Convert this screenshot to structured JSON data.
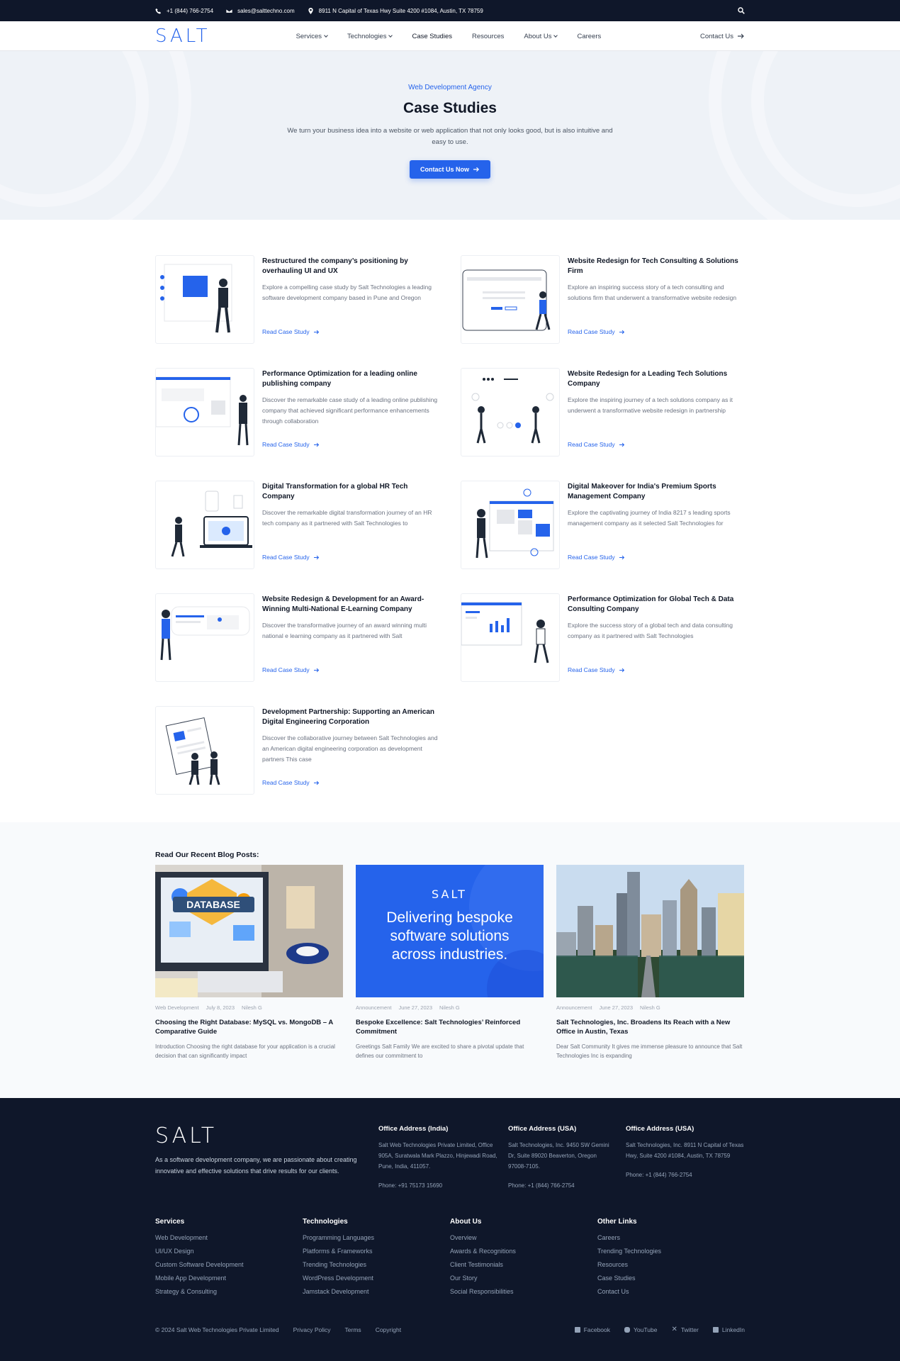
{
  "topbar": {
    "phone": "+1 (844) 766-2754",
    "email": "sales@salttechno.com",
    "address": "8911 N Capital of Texas Hwy Suite 4200 #1084, Austin, TX 78759",
    "icons": [
      "phone-icon",
      "mail-icon",
      "location-icon",
      "search-icon"
    ]
  },
  "nav": {
    "logo": "SALT",
    "items": [
      {
        "label": "Services"
      },
      {
        "label": "Technologies"
      },
      {
        "label": "Case Studies"
      },
      {
        "label": "Resources"
      },
      {
        "label": "About Us"
      },
      {
        "label": "Careers"
      }
    ],
    "contact": "Contact Us"
  },
  "hero": {
    "eyebrow": "Web Development Agency",
    "title": "Case Studies",
    "description": "We turn your business idea into a website or web application that not only looks good, but is also intuitive and easy to use.",
    "button": "Contact Us Now"
  },
  "cases": [
    {
      "title": "Restructured the company’s positioning by overhauling UI and UX",
      "desc": "Explore a compelling case study by Salt Technologies a leading software development company based in Pune and Oregon",
      "link": "Read Case Study"
    },
    {
      "title": "Website Redesign for Tech Consulting & Solutions Firm",
      "desc": "Explore an inspiring success story of a tech consulting and solutions firm that underwent a transformative website redesign",
      "link": "Read Case Study"
    },
    {
      "title": "Performance Optimization for a leading online publishing company",
      "desc": "Discover the remarkable case study of a leading online publishing company that achieved significant performance enhancements through collaboration",
      "link": "Read Case Study"
    },
    {
      "title": "Website Redesign for a Leading Tech Solutions Company",
      "desc": "Explore the inspiring journey of a tech solutions company as it underwent a transformative website redesign in partnership",
      "link": "Read Case Study"
    },
    {
      "title": "Digital Transformation for a global HR Tech Company",
      "desc": "Discover the remarkable digital transformation journey of an HR tech company as it partnered with Salt Technologies to",
      "link": "Read Case Study"
    },
    {
      "title": "Digital Makeover for India's Premium Sports Management Company",
      "desc": "Explore the captivating journey of India 8217 s leading sports management company as it selected Salt Technologies for",
      "link": "Read Case Study"
    },
    {
      "title": "Website Redesign & Development for an Award-Winning Multi-National E-Learning Company",
      "desc": "Discover the transformative journey of an award winning multi national e learning company as it partnered with Salt",
      "link": "Read Case Study"
    },
    {
      "title": "Performance Optimization for Global Tech & Data Consulting Company",
      "desc": "Explore the success story of a global tech and data consulting company as it partnered with Salt Technologies",
      "link": "Read Case Study"
    },
    {
      "title": "Development Partnership: Supporting an American Digital Engineering Corporation",
      "desc": "Discover the collaborative journey between Salt Technologies and an American digital engineering corporation as development partners This case",
      "link": "Read Case Study"
    }
  ],
  "blog": {
    "heading": "Read Our Recent Blog Posts:",
    "posts": [
      {
        "category": "Web Development",
        "date": "July 8, 2023",
        "author": "Nilesh G",
        "title": "Choosing the Right Database: MySQL vs. MongoDB – A Comparative Guide",
        "excerpt": "Introduction Choosing the right database for your application is a crucial decision that can significantly impact",
        "img_text": "DATABASE"
      },
      {
        "category": "Announcement",
        "date": "June 27, 2023",
        "author": "Nilesh G",
        "title": "Bespoke Excellence: Salt Technologies’ Reinforced Commitment",
        "excerpt": "Greetings Salt Family We are excited to share a pivotal update that defines our commitment to",
        "img_logo": "SALT",
        "img_text": "Delivering bespoke software solutions across industries."
      },
      {
        "category": "Announcement",
        "date": "June 27, 2023",
        "author": "Nilesh G",
        "title": "Salt Technologies, Inc. Broadens Its Reach with a New Office in Austin, Texas",
        "excerpt": "Dear Salt Community It gives me immense pleasure to announce that Salt Technologies Inc is expanding"
      }
    ]
  },
  "footer": {
    "logo": "SALT",
    "about": "As a software development company, we are passionate about creating innovative and effective solutions that drive results for our clients.",
    "offices": [
      {
        "title": "Office Address (India)",
        "address": "Salt Web Technologies Private Limited, Office 905A, Suratwala Mark Plazzo, Hinjewadi Road, Pune, India, 411057.",
        "phone": "Phone: +91 75173 15690"
      },
      {
        "title": "Office Address (USA)",
        "address": "Salt Technologies, Inc. 9450 SW Gemini Dr, Suite 89020 Beaverton, Oregon 97008-7105.",
        "phone": "Phone: +1 (844) 766-2754"
      },
      {
        "title": "Office Address (USA)",
        "address": "Salt Technologies, Inc. 8911 N Capital of Texas Hwy, Suite 4200 #1084, Austin, TX 78759",
        "phone": "Phone: +1 (844) 766-2754"
      }
    ],
    "columns": [
      {
        "title": "Services",
        "links": [
          "Web Development",
          "UI/UX Design",
          "Custom Software Development",
          "Mobile App Development",
          "Strategy & Consulting"
        ]
      },
      {
        "title": "Technologies",
        "links": [
          "Programming Languages",
          "Platforms & Frameworks",
          "Trending Technologies",
          "WordPress Development",
          "Jamstack Development"
        ]
      },
      {
        "title": "About Us",
        "links": [
          "Overview",
          "Awards & Recognitions",
          "Client Testimonials",
          "Our Story",
          "Social Responsibilities"
        ]
      },
      {
        "title": "Other Links",
        "links": [
          "Careers",
          "Trending Technologies",
          "Resources",
          "Case Studies",
          "Contact Us"
        ]
      }
    ],
    "copyright": "© 2024 Salt Web Technologies Private Limited",
    "legal": [
      "Privacy Policy",
      "Terms",
      "Copyright"
    ],
    "social": [
      {
        "label": "Facebook",
        "icon": "facebook-icon"
      },
      {
        "label": "YouTube",
        "icon": "youtube-icon"
      },
      {
        "label": "Twitter",
        "icon": "x-icon"
      },
      {
        "label": "LinkedIn",
        "icon": "linkedin-icon"
      }
    ]
  },
  "colors": {
    "accent": "#2563eb",
    "dark": "#0f172a",
    "hero_bg": "#eef2f7"
  }
}
